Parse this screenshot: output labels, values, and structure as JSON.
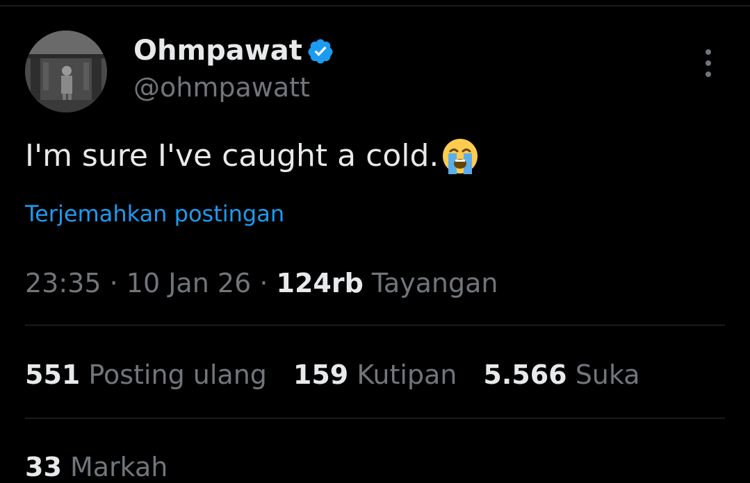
{
  "author": {
    "display_name": "Ohmpawat",
    "handle": "@ohmpawatt",
    "verified": true,
    "verified_color": "#1d9bf0"
  },
  "tweet": {
    "text": "I'm sure I've caught a cold.",
    "emoji": "loudly-crying-face-emoji",
    "translate_label": "Terjemahkan postingan"
  },
  "meta": {
    "time": "23:35",
    "separator": "·",
    "date": "10 Jan 26",
    "views_count": "124rb",
    "views_label": "Tayangan"
  },
  "stats": {
    "reposts_count": "551",
    "reposts_label": "Posting ulang",
    "quotes_count": "159",
    "quotes_label": "Kutipan",
    "likes_count": "5.566",
    "likes_label": "Suka",
    "bookmarks_count": "33",
    "bookmarks_label": "Markah"
  },
  "colors": {
    "background": "#000000",
    "text_primary": "#e7e9ea",
    "text_secondary": "#71767b",
    "link": "#1d9bf0",
    "divider": "#2f3336"
  },
  "icons": {
    "more": "more-vertical-icon",
    "verified": "verified-badge-icon"
  }
}
